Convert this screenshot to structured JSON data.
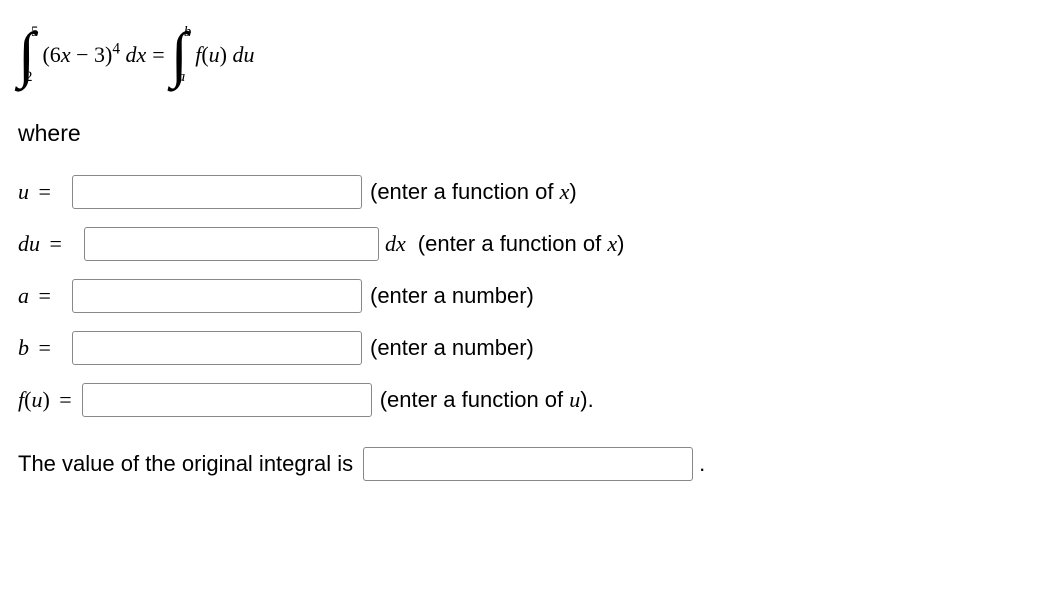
{
  "equation": {
    "int1_lower": "2",
    "int1_upper": "5",
    "integrand1_pre": "(6",
    "integrand1_x": "x",
    "integrand1_mid": " − 3)",
    "integrand1_exp": "4",
    "integrand1_dx_d": " d",
    "integrand1_dx_x": "x",
    "equals": " = ",
    "int2_lower": "a",
    "int2_upper": "b",
    "integrand2_f": "f",
    "integrand2_paren_open": "(",
    "integrand2_u": "u",
    "integrand2_paren_close": ") ",
    "integrand2_du_d": "d",
    "integrand2_du_u": "u"
  },
  "where": "where",
  "rows": {
    "u": {
      "label_var": "u",
      "eq": " =",
      "hint_pre": "(enter a function of ",
      "hint_var": "x",
      "hint_post": ")"
    },
    "du": {
      "label_var": "du",
      "eq": " =",
      "dx": "dx",
      "hint_pre": "(enter a function of ",
      "hint_var": "x",
      "hint_post": ")"
    },
    "a": {
      "label_var": "a",
      "eq": " =",
      "hint": "(enter a number)"
    },
    "b": {
      "label_var": "b",
      "eq": " =",
      "hint": "(enter a number)"
    },
    "fu": {
      "label_f": "f",
      "label_open": "(",
      "label_u": "u",
      "label_close": ")",
      "eq": " =",
      "hint_pre": "(enter a function of ",
      "hint_var": "u",
      "hint_post": ")."
    }
  },
  "final": {
    "label": "The value of the original integral is",
    "period": "."
  }
}
